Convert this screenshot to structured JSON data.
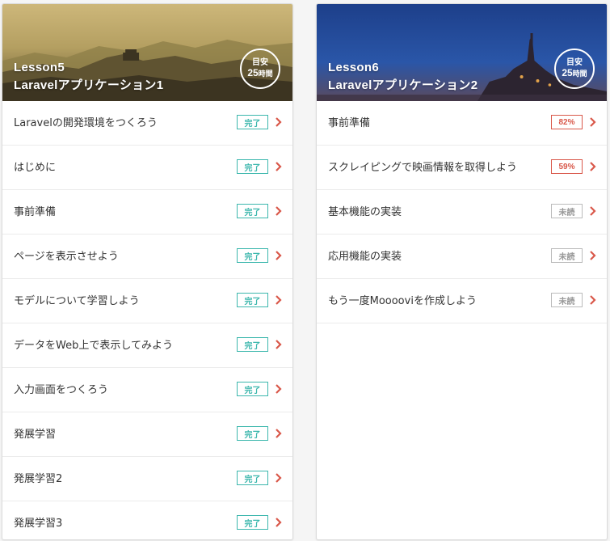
{
  "colors": {
    "done": "#3cb7ad",
    "progress": "#d9584a",
    "unread": "#bbbbbb",
    "chevron": "#d9584a"
  },
  "lessons": [
    {
      "lesson_label": "Lesson5",
      "title": "Laravelアプリケーション1",
      "badge_top": "目安",
      "badge_hours": "25",
      "badge_unit": "時間",
      "items": [
        {
          "label": "Laravelの開発環境をつくろう",
          "status": "完了"
        },
        {
          "label": "はじめに",
          "status": "完了"
        },
        {
          "label": "事前準備",
          "status": "完了"
        },
        {
          "label": "ページを表示させよう",
          "status": "完了"
        },
        {
          "label": "モデルについて学習しよう",
          "status": "完了"
        },
        {
          "label": "データをWeb上で表示してみよう",
          "status": "完了"
        },
        {
          "label": "入力画面をつくろう",
          "status": "完了"
        },
        {
          "label": "発展学習",
          "status": "完了"
        },
        {
          "label": "発展学習2",
          "status": "完了"
        },
        {
          "label": "発展学習3",
          "status": "完了"
        }
      ]
    },
    {
      "lesson_label": "Lesson6",
      "title": "Laravelアプリケーション2",
      "badge_top": "目安",
      "badge_hours": "25",
      "badge_unit": "時間",
      "items": [
        {
          "label": "事前準備",
          "status": "82%"
        },
        {
          "label": "スクレイピングで映画情報を取得しよう",
          "status": "59%"
        },
        {
          "label": "基本機能の実装",
          "status": "未読"
        },
        {
          "label": "応用機能の実装",
          "status": "未読"
        },
        {
          "label": "もう一度Mooooviを作成しよう",
          "status": "未読"
        }
      ]
    }
  ]
}
